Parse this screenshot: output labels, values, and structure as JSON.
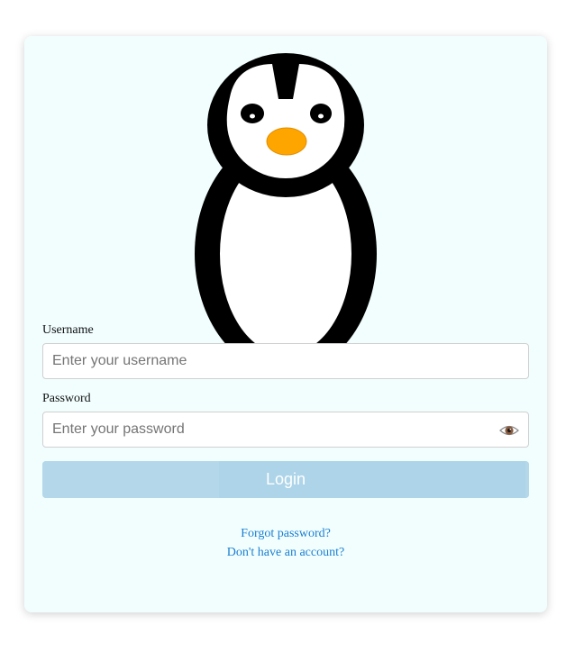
{
  "form": {
    "username_label": "Username",
    "username_placeholder": "Enter your username",
    "username_value": "",
    "password_label": "Password",
    "password_placeholder": "Enter your password",
    "password_value": "",
    "login_label": "Login",
    "forgot_password_label": "Forgot password?",
    "signup_label": "Don't have an account?"
  },
  "icons": {
    "mascot": "penguin-mascot",
    "password_toggle": "eye-icon"
  },
  "colors": {
    "card_background": "#f2fefe",
    "button_background": "#add4e8",
    "link": "#1a7fd1",
    "beak": "#ffa500"
  }
}
